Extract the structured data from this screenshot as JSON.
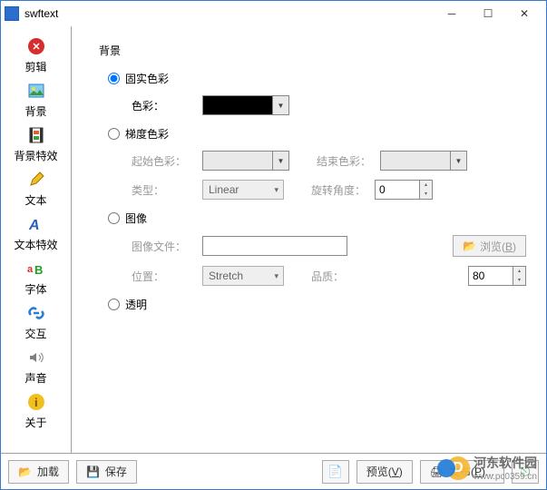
{
  "title": "swftext",
  "sidebar": [
    {
      "label": "剪辑",
      "icon": "scissors-icon",
      "color": "#d62e2e"
    },
    {
      "label": "背景",
      "icon": "image-icon",
      "color": "#2a7fd5"
    },
    {
      "label": "背景特效",
      "icon": "film-icon",
      "color": "#d08a2a"
    },
    {
      "label": "文本",
      "icon": "pencil-icon",
      "color": "#f0c020"
    },
    {
      "label": "文本特效",
      "icon": "text-effect-icon",
      "color": "#2e5dc0"
    },
    {
      "label": "字体",
      "icon": "font-icon",
      "color": "#d62e2e"
    },
    {
      "label": "交互",
      "icon": "link-icon",
      "color": "#2a7fd5"
    },
    {
      "label": "声音",
      "icon": "speaker-icon",
      "color": "#808080"
    },
    {
      "label": "关于",
      "icon": "info-icon",
      "color": "#f0c020"
    }
  ],
  "section_title": "背景",
  "radios": {
    "solid": "固实色彩",
    "gradient": "梯度色彩",
    "image": "图像",
    "transparent": "透明"
  },
  "solid": {
    "color_label": "色彩：",
    "color_value": "#000000"
  },
  "gradient": {
    "start_label": "起始色彩：",
    "end_label": "结束色彩：",
    "type_label": "类型：",
    "type_value": "Linear",
    "angle_label": "旋转角度：",
    "angle_value": "0"
  },
  "image": {
    "file_label": "图像文件：",
    "file_value": "",
    "browse_label": "浏览(B)",
    "position_label": "位置：",
    "position_value": "Stretch",
    "quality_label": "品质：",
    "quality_value": "80"
  },
  "bottom": {
    "load_label": "加载",
    "save_label": "保存",
    "preview_label": "预览(V)",
    "publish_label": "发布(P)..."
  },
  "watermark": {
    "site": "河东软件园",
    "url": "www.pc0359.cn"
  }
}
